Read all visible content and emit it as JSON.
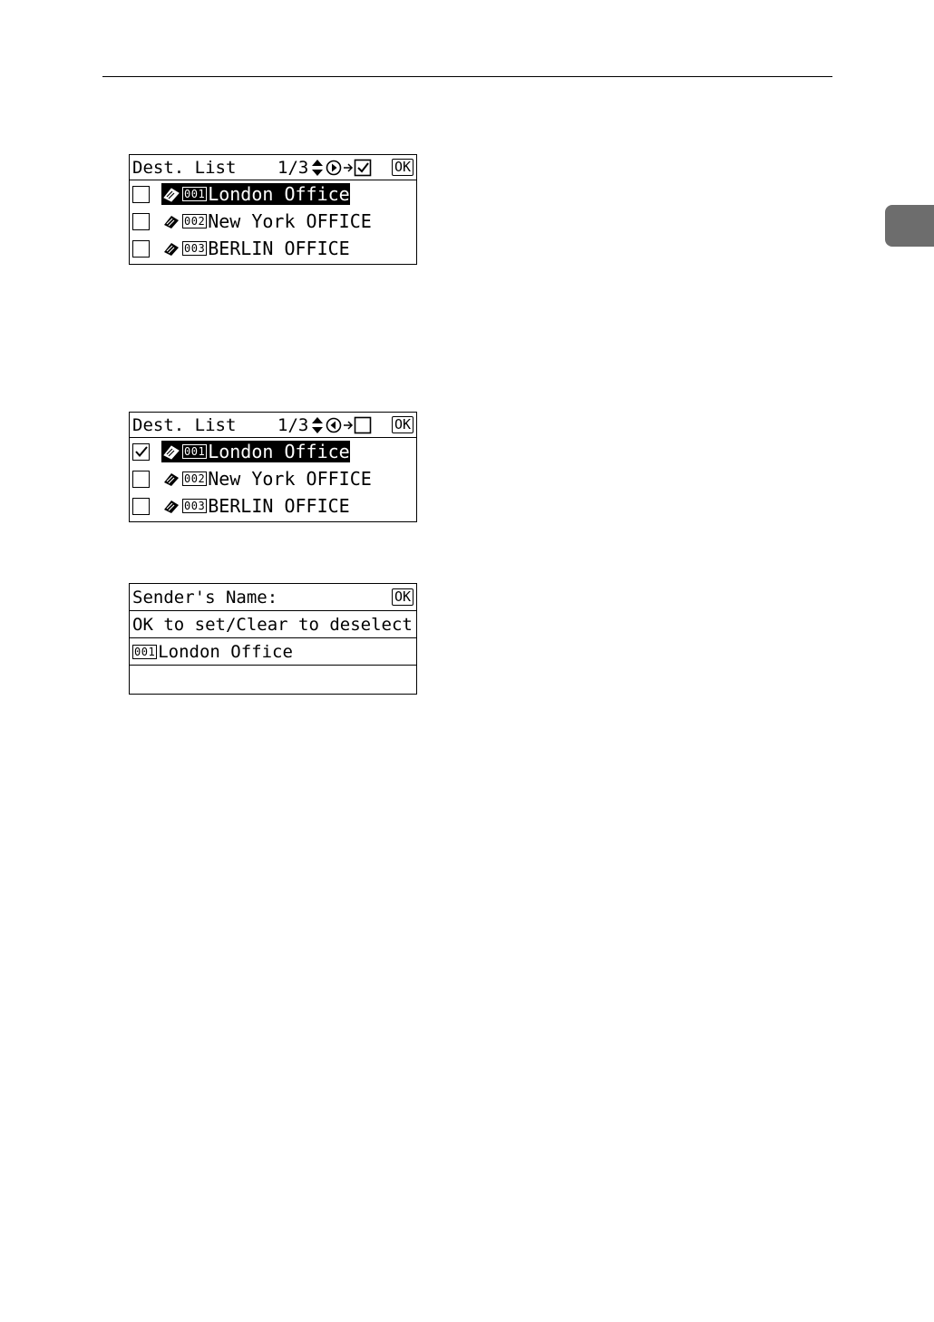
{
  "screen1": {
    "title": "Dest. List",
    "pager": "1/3",
    "ok_label": "OK",
    "rows": [
      {
        "num": "001",
        "name": "London Office",
        "checked": false,
        "selected": true
      },
      {
        "num": "002",
        "name": "New York OFFICE",
        "checked": false,
        "selected": false
      },
      {
        "num": "003",
        "name": "BERLIN OFFICE",
        "checked": false,
        "selected": false
      }
    ]
  },
  "screen2": {
    "title": "Dest. List",
    "pager": "1/3",
    "ok_label": "OK",
    "rows": [
      {
        "num": "001",
        "name": "London Office",
        "checked": true,
        "selected": true
      },
      {
        "num": "002",
        "name": "New York OFFICE",
        "checked": false,
        "selected": false
      },
      {
        "num": "003",
        "name": "BERLIN OFFICE",
        "checked": false,
        "selected": false
      }
    ]
  },
  "screen3": {
    "title": "Sender's Name:",
    "ok_label": "OK",
    "instruction": "OK to set/Clear to deselect",
    "entry_num": "001",
    "entry_name": "London Office"
  },
  "icons": [
    "destination-book-icon",
    "up-down-arrow-icon",
    "right-arrow-circle-icon",
    "left-arrow-circle-icon",
    "checkbox-icon"
  ]
}
